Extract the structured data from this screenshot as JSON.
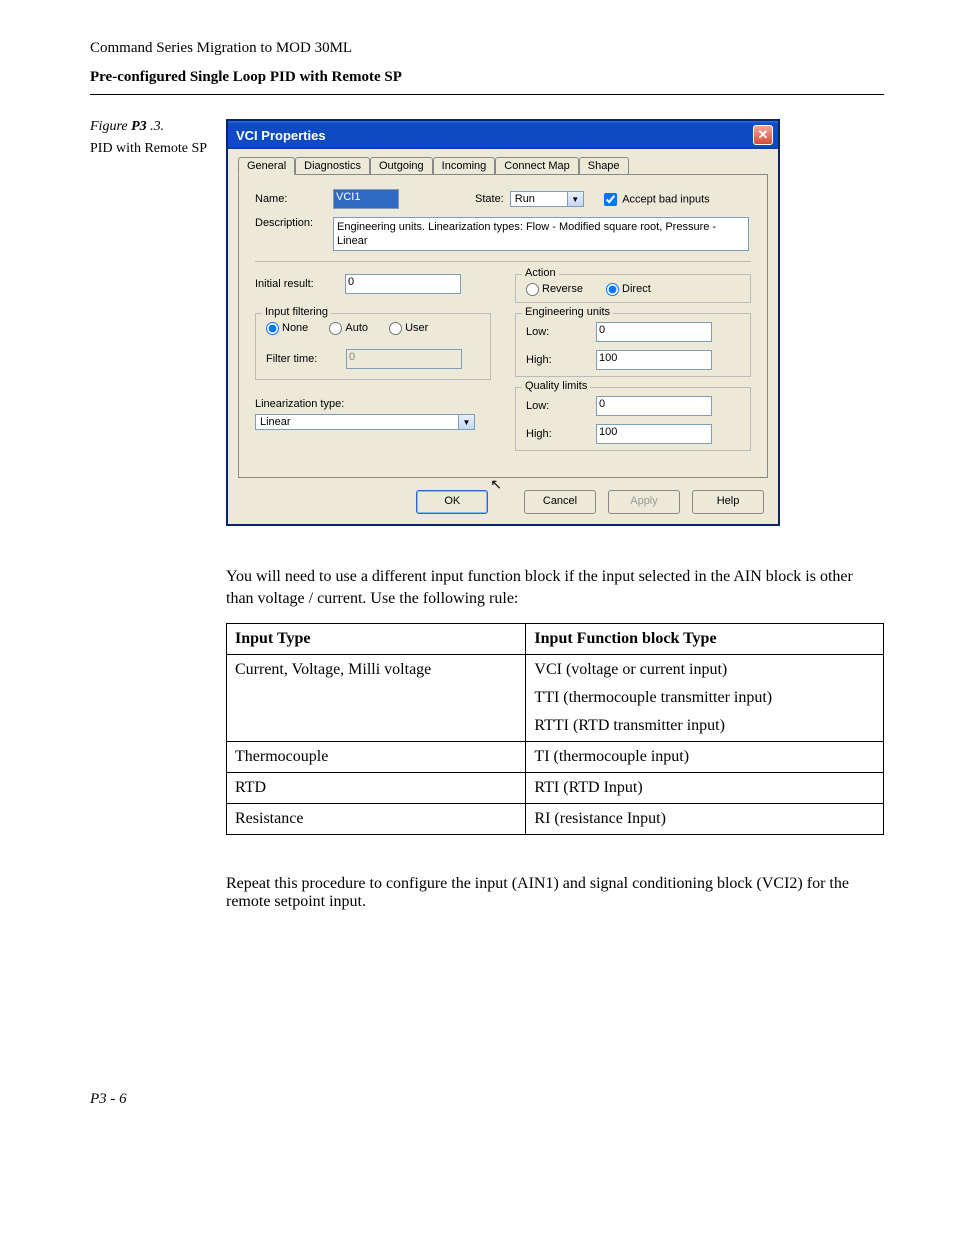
{
  "header": {
    "title": "Command Series Migration to MOD 30ML",
    "subtitle": "Pre-configured Single Loop PID with Remote SP"
  },
  "figure": {
    "label_prefix": "Figure ",
    "label_bold": "P3",
    "label_suffix": " .3.",
    "caption": "PID with Remote SP"
  },
  "dialog": {
    "title": "VCI Properties",
    "tabs": [
      "General",
      "Diagnostics",
      "Outgoing",
      "Incoming",
      "Connect Map",
      "Shape"
    ],
    "active_tab": 0,
    "name_label": "Name:",
    "name_value": "VCI1",
    "state_label": "State:",
    "state_value": "Run",
    "accept_label": "Accept bad inputs",
    "accept_checked": true,
    "description_label": "Description:",
    "description_value": "Engineering units. Linearization types: Flow - Modified square root, Pressure - Linear",
    "initial_result_label": "Initial result:",
    "initial_result_value": "0",
    "action": {
      "title": "Action",
      "reverse": "Reverse",
      "direct": "Direct",
      "selected": "direct"
    },
    "input_filtering": {
      "title": "Input filtering",
      "none": "None",
      "auto": "Auto",
      "user": "User",
      "selected": "none",
      "filter_time_label": "Filter time:",
      "filter_time_value": "0"
    },
    "engineering_units": {
      "title": "Engineering units",
      "low_label": "Low:",
      "low_value": "0",
      "high_label": "High:",
      "high_value": "100"
    },
    "linearization_label": "Linearization type:",
    "linearization_value": "Linear",
    "quality_limits": {
      "title": "Quality limits",
      "low_label": "Low:",
      "low_value": "0",
      "high_label": "High:",
      "high_value": "100"
    },
    "buttons": {
      "ok": "OK",
      "cancel": "Cancel",
      "apply": "Apply",
      "help": "Help"
    }
  },
  "body": {
    "para1": "You will need to use a different input function block if the input selected in the AIN block is other than voltage / current. Use the following rule:",
    "para2": "Repeat this procedure to configure the input (AIN1) and signal conditioning block (VCI2) for the remote setpoint input."
  },
  "table": {
    "headers": [
      "Input Type",
      "Input Function block Type"
    ],
    "rows": [
      {
        "c1": "Current, Voltage, Milli voltage",
        "c2": [
          "VCI (voltage or current input)",
          "TTI (thermocouple transmitter input)",
          "RTTI (RTD transmitter input)"
        ]
      },
      {
        "c1": "Thermocouple",
        "c2": [
          "TI (thermocouple input)"
        ]
      },
      {
        "c1": "RTD",
        "c2": [
          "RTI (RTD Input)"
        ]
      },
      {
        "c1": "Resistance",
        "c2": [
          "RI (resistance Input)"
        ]
      }
    ]
  },
  "page_number": "P3 - 6"
}
